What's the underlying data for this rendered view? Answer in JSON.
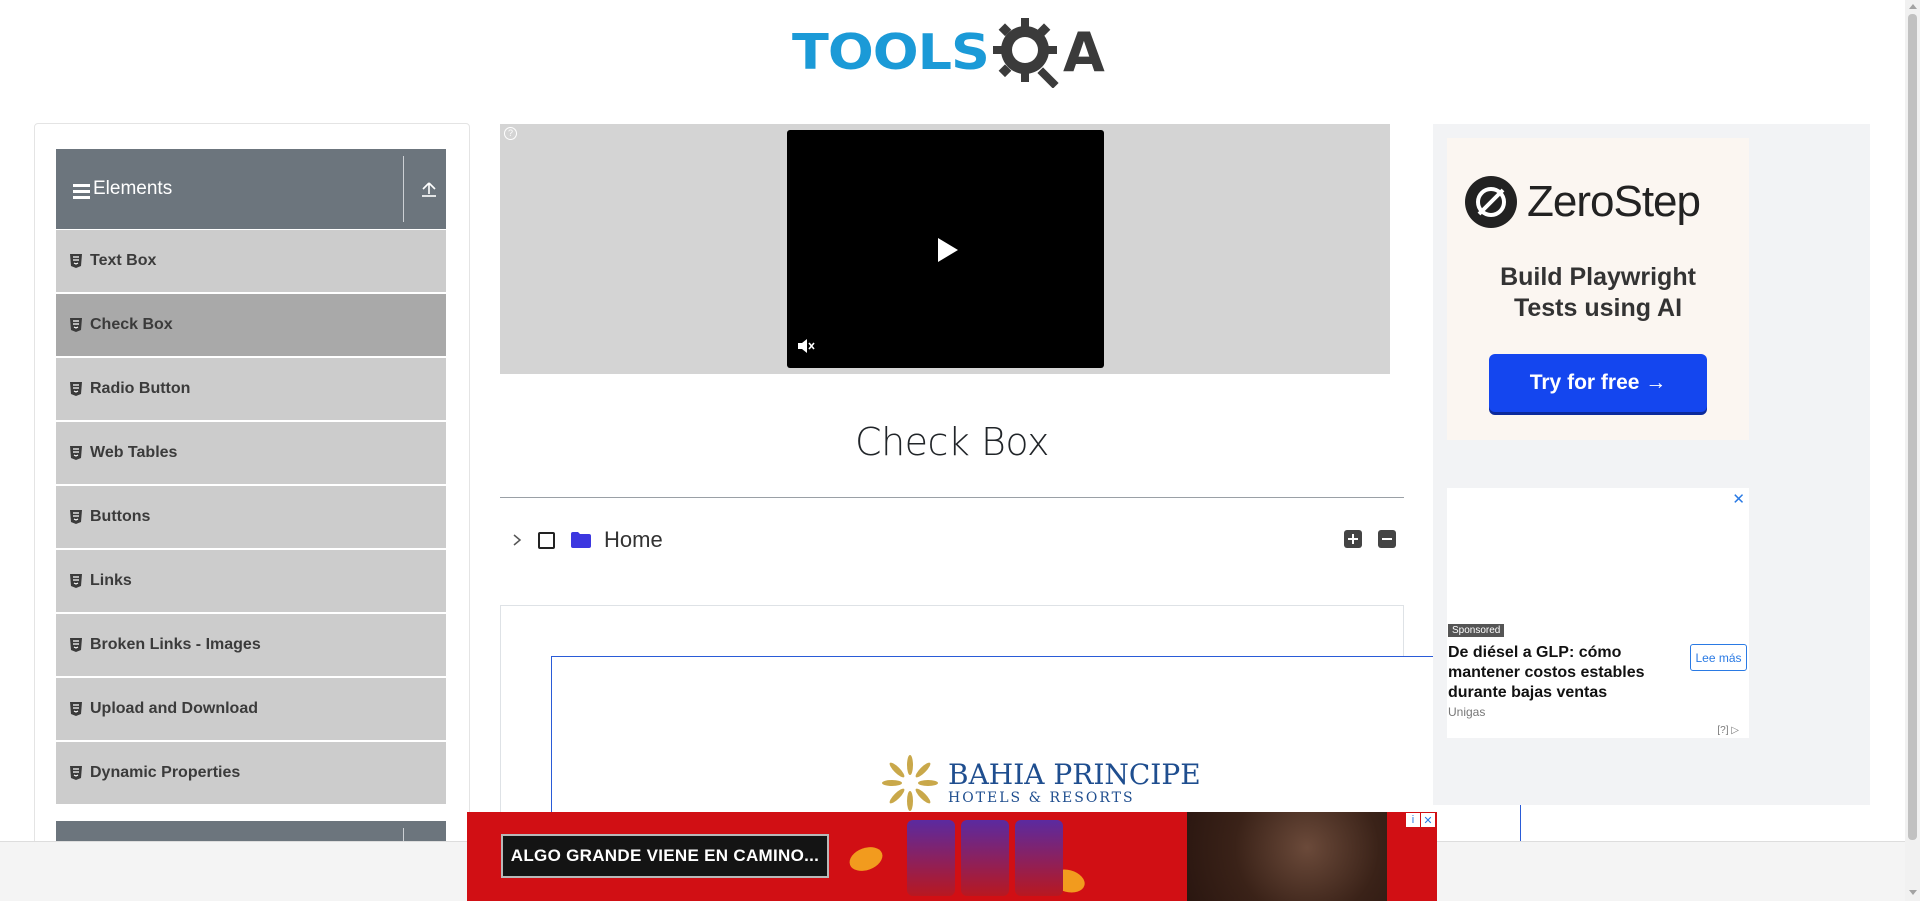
{
  "header": {
    "logo_text_tools": "TOOLS",
    "logo_text_a": "A",
    "logo_gear_icon": "gear-magnifier-icon"
  },
  "sidebar": {
    "group_title": "Elements",
    "items": [
      {
        "label": "Text Box",
        "active": false
      },
      {
        "label": "Check Box",
        "active": true
      },
      {
        "label": "Radio Button",
        "active": false
      },
      {
        "label": "Web Tables",
        "active": false
      },
      {
        "label": "Buttons",
        "active": false
      },
      {
        "label": "Links",
        "active": false
      },
      {
        "label": "Broken Links - Images",
        "active": false
      },
      {
        "label": "Upload and Download",
        "active": false
      },
      {
        "label": "Dynamic Properties",
        "active": false
      }
    ]
  },
  "video_ad": {
    "info_label": "?"
  },
  "main": {
    "title": "Check Box",
    "tree": {
      "root_label": "Home",
      "expanded": false,
      "checked": false
    }
  },
  "inner_ad": {
    "brand_name": "BAHIA PRINCIPE",
    "brand_sub": "HOTELS & RESORTS"
  },
  "right_ads": {
    "zerostep": {
      "brand": "ZeroStep",
      "tagline_line1": "Build Playwright",
      "tagline_line2": "Tests using AI",
      "cta": "Try for free →"
    },
    "native": {
      "close": "✕",
      "sponsored": "Sponsored",
      "headline": "De diésel a GLP: cómo mantener costos estables durante bajas ventas",
      "more_button": "Lee más",
      "advertiser": "Unigas",
      "adchoices": "[?]"
    }
  },
  "bottom_ad": {
    "message": "ALGO GRANDE VIENE EN CAMINO..."
  },
  "colors": {
    "logo_blue": "#1b9ad7",
    "logo_dark": "#3b3b3b",
    "sidebar_header": "#6c757d",
    "menu_item": "#cccccc",
    "menu_item_active": "#a9a9a9",
    "cta_blue": "#1446ef",
    "bottom_ad_red": "#d10f14"
  }
}
